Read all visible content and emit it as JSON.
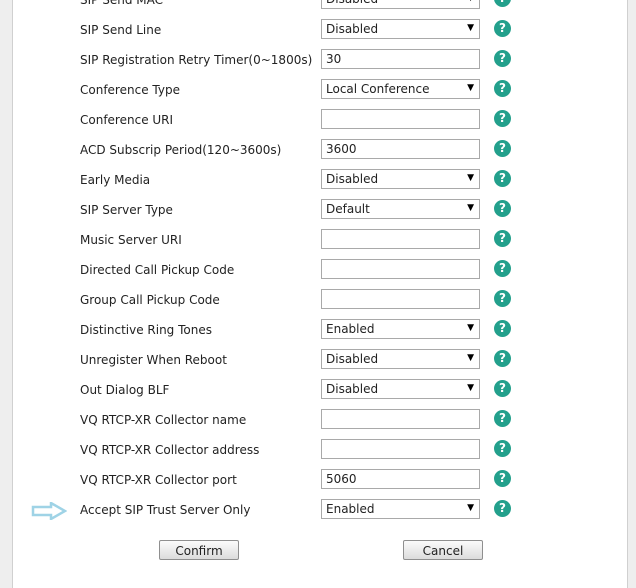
{
  "rows": [
    {
      "label": "SIP Send MAC",
      "type": "select",
      "value": "Disabled"
    },
    {
      "label": "SIP Send Line",
      "type": "select",
      "value": "Disabled"
    },
    {
      "label": "SIP Registration Retry Timer(0~1800s)",
      "type": "input",
      "value": "30"
    },
    {
      "label": "Conference Type",
      "type": "select",
      "value": "Local Conference"
    },
    {
      "label": "Conference URI",
      "type": "input",
      "value": ""
    },
    {
      "label": "ACD Subscrip Period(120~3600s)",
      "type": "input",
      "value": "3600"
    },
    {
      "label": "Early Media",
      "type": "select",
      "value": "Disabled"
    },
    {
      "label": "SIP Server Type",
      "type": "select",
      "value": "Default"
    },
    {
      "label": "Music Server URI",
      "type": "input",
      "value": ""
    },
    {
      "label": "Directed Call Pickup Code",
      "type": "input",
      "value": ""
    },
    {
      "label": "Group Call Pickup Code",
      "type": "input",
      "value": ""
    },
    {
      "label": "Distinctive Ring Tones",
      "type": "select",
      "value": "Enabled"
    },
    {
      "label": "Unregister When Reboot",
      "type": "select",
      "value": "Disabled"
    },
    {
      "label": "Out Dialog BLF",
      "type": "select",
      "value": "Disabled"
    },
    {
      "label": "VQ RTCP-XR Collector name",
      "type": "input",
      "value": ""
    },
    {
      "label": "VQ RTCP-XR Collector address",
      "type": "input",
      "value": ""
    },
    {
      "label": "VQ RTCP-XR Collector port",
      "type": "input",
      "value": "5060"
    },
    {
      "label": "Accept SIP Trust Server Only",
      "type": "select",
      "value": "Enabled"
    }
  ],
  "help_glyph": "?",
  "dropdown_glyph": "▼",
  "buttons": {
    "confirm": "Confirm",
    "cancel": "Cancel"
  },
  "colors": {
    "help_icon": "#23a08c",
    "highlight_arrow": "#9fd3e6"
  }
}
